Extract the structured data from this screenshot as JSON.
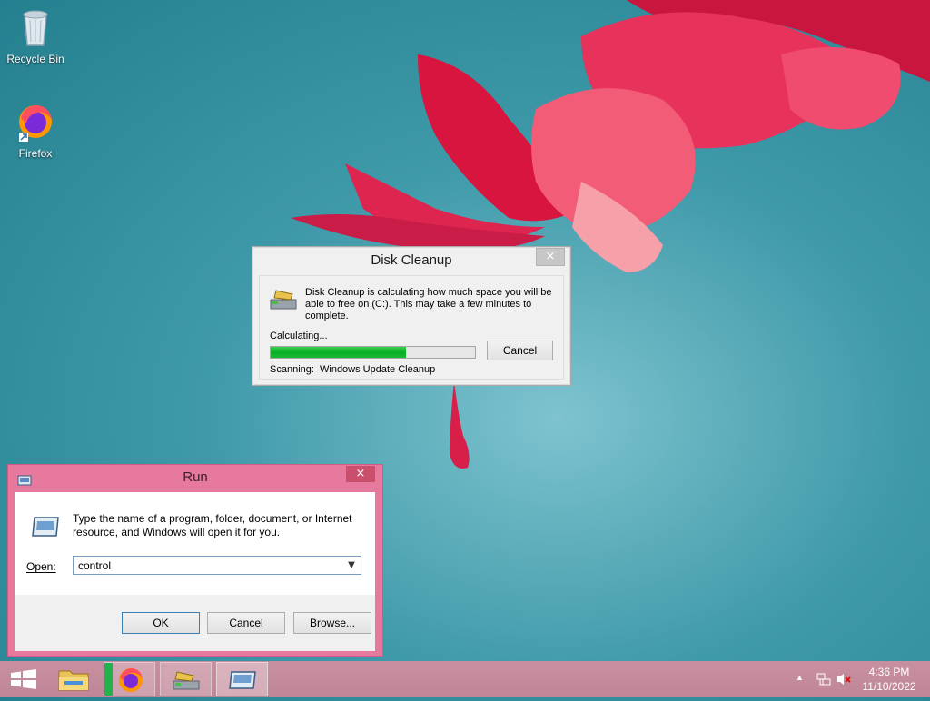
{
  "desktop": {
    "icons": [
      {
        "label": "Recycle Bin",
        "icon": "recycle-bin-icon"
      },
      {
        "label": "Firefox",
        "icon": "firefox-icon"
      }
    ]
  },
  "disk_cleanup": {
    "title": "Disk Cleanup",
    "close_glyph": "×",
    "message": "Disk Cleanup is calculating how much space you will be able to free on  (C:). This may take a few minutes to complete.",
    "status": "Calculating...",
    "progress_percent": 66,
    "cancel_label": "Cancel",
    "scanning_label": "Scanning:",
    "scanning_value": "Windows Update Cleanup",
    "icon": "disk-cleanup-icon"
  },
  "run": {
    "title": "Run",
    "close_glyph": "×",
    "message": "Type the name of a program, folder, document, or Internet resource, and Windows will open it for you.",
    "open_label": "Open:",
    "open_value": "control",
    "ok_label": "OK",
    "cancel_label": "Cancel",
    "browse_label": "Browse...",
    "icon": "run-icon"
  },
  "taskbar": {
    "items": [
      "start-icon",
      "file-explorer-icon",
      "firefox-icon",
      "disk-cleanup-icon",
      "run-icon"
    ],
    "tray": {
      "time": "4:36 PM",
      "date": "11/10/2022"
    }
  },
  "colors": {
    "accent_run": "#e7799e",
    "progress_green": "#06b025"
  }
}
